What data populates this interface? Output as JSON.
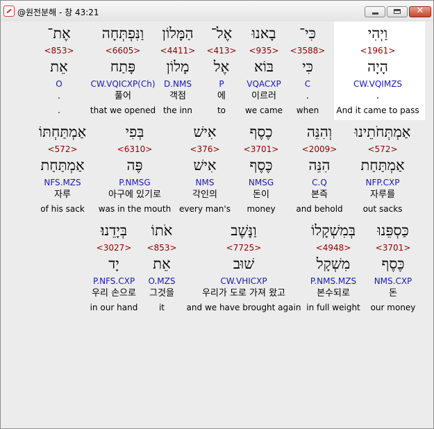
{
  "window": {
    "title": "@원전분해 - 창 43:21",
    "close_label": "✕"
  },
  "rows": [
    [
      {
        "heb": "וַיְהִי",
        "strong": "<1961>",
        "lex": "הָיָה",
        "parse": "CW.VQIMZS",
        "kor": ".",
        "eng": "And it came to pass"
      },
      {
        "heb": "כִּי־",
        "strong": "<3588>",
        "lex": "כִּי",
        "parse": "C",
        "kor": ".",
        "eng": "when"
      },
      {
        "heb": "בָאנוּ",
        "strong": "<935>",
        "lex": "בּוֹא",
        "parse": "VQACXP",
        "kor": "이르러",
        "eng": "we came"
      },
      {
        "heb": "אֶל־",
        "strong": "<413>",
        "lex": "אֶל",
        "parse": "P",
        "kor": "에",
        "eng": "to"
      },
      {
        "heb": "הַמָּלוֹן",
        "strong": "<4411>",
        "lex": "מָלוֹן",
        "parse": "D.NMS",
        "kor": "객점",
        "eng": "the inn"
      },
      {
        "heb": "וַנִּפְתְּחָה",
        "strong": "<6605>",
        "lex": "פָּתַח",
        "parse": "CW.VQICXP(Ch)",
        "kor": "풀어",
        "eng": "that we opened"
      },
      {
        "heb": "אֶת־",
        "strong": "<853>",
        "lex": "אֵת",
        "parse": "O",
        "kor": ".",
        "eng": "."
      }
    ],
    [
      {
        "heb": "אַמְתְּחֹתֵינוּ",
        "strong": "<572>",
        "lex": "אַמְתַּחַת",
        "parse": "NFP.CXP",
        "kor": "자루를",
        "eng": "out sacks"
      },
      {
        "heb": "וְהִנֵּה",
        "strong": "<2009>",
        "lex": "הִנֵּה",
        "parse": "C.Q",
        "kor": "본즉",
        "eng": "and behold"
      },
      {
        "heb": "כֶסֶף",
        "strong": "<3701>",
        "lex": "כֶּסֶף",
        "parse": "NMSG",
        "kor": "돈이",
        "eng": "money"
      },
      {
        "heb": "אִישׁ",
        "strong": "<376>",
        "lex": "אִישׁ",
        "parse": "NMS",
        "kor": "각인의",
        "eng": "every man's"
      },
      {
        "heb": "בְּפִי",
        "strong": "<6310>",
        "lex": "פֶּה",
        "parse": "P.NMSG",
        "kor": "아구에 있기로",
        "eng": "was in the mouth"
      },
      {
        "heb": "אַמְתַּחְתּוֹ",
        "strong": "<572>",
        "lex": "אַמְתַּחַת",
        "parse": "NFS.MZS",
        "kor": "자루",
        "eng": "of his sack"
      }
    ],
    [
      {
        "heb": "כַּסְפֵּנוּ",
        "strong": "<3701>",
        "lex": "כֶּסֶף",
        "parse": "NMS.CXP",
        "kor": "돈",
        "eng": "our money"
      },
      {
        "heb": "בְּמִשְׁקָלוֹ",
        "strong": "<4948>",
        "lex": "מִשְׁקָל",
        "parse": "P.NMS.MZS",
        "kor": "본수되로",
        "eng": "in full weight"
      },
      {
        "heb": "וַנָּשֶׁב",
        "strong": "<7725>",
        "lex": "שׁוּב",
        "parse": "CW.VHICXP",
        "kor": "우리가 도로 가져 왔고",
        "eng": "and we have brought again"
      },
      {
        "heb": "אֹתוֹ",
        "strong": "<853>",
        "lex": "אֵת",
        "parse": "O.MZS",
        "kor": "그것을",
        "eng": "it"
      },
      {
        "heb": "בְּיָדֵנוּ׃",
        "strong": "<3027>",
        "lex": "יָד",
        "parse": "P.NFS.CXP",
        "kor": "우리 손으로",
        "eng": "in our hand"
      }
    ]
  ]
}
